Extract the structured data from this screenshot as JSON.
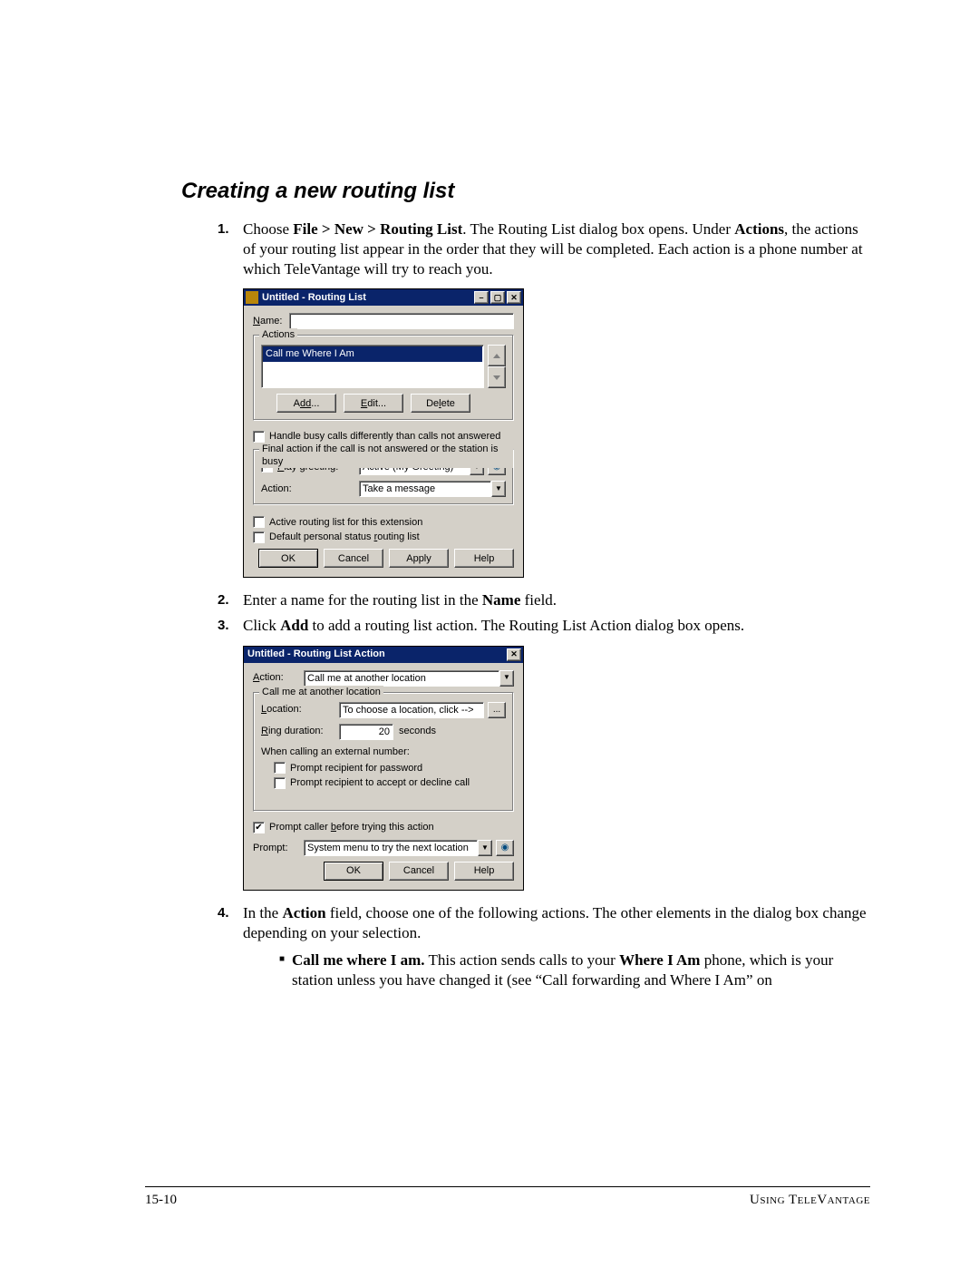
{
  "heading": "Creating a new routing list",
  "step1": {
    "pre": "Choose ",
    "bold1": "File > New > Routing List",
    "mid1": ". The Routing List dialog box opens. Under ",
    "bold2": "Actions",
    "tail": ", the actions of your routing list appear in the order that they will be completed. Each action is a phone number at which TeleVantage will try to reach you."
  },
  "step2": {
    "pre": "Enter a name for the routing list in the ",
    "b": "Name",
    "post": " field."
  },
  "step3": {
    "pre": "Click ",
    "b": "Add",
    "post": " to add a routing list action. The Routing List Action dialog box opens."
  },
  "step4": {
    "pre": "In the ",
    "b": "Action",
    "post": " field, choose one of the following actions. The other elements in the dialog box change depending on your selection."
  },
  "step4sub": {
    "b1": "Call me where I am.",
    "mid": " This action sends calls to your ",
    "b2": "Where I Am",
    "tail": " phone, which is your station unless you have changed it (see “Call forwarding and Where I Am” on"
  },
  "dlg1": {
    "title": "Untitled - Routing List",
    "name_label_a": "N",
    "name_label_b": "ame:",
    "actions_legend": "Actions",
    "list_item": "Call me Where I Am",
    "btn_add_a": "A",
    "btn_add_b": "dd",
    "btn_add_c": "...",
    "btn_edit_a": "E",
    "btn_edit_b": "dit...",
    "btn_delete_a": "De",
    "btn_delete_b": "l",
    "btn_delete_c": "ete",
    "handle_busy": "Handle busy calls differently than calls not answered",
    "final_legend": "Final action if the call is not answered or the station is busy",
    "play_a": "P",
    "play_b": "lay greeting:",
    "greeting_value": "Active (My Greeting)",
    "action_label": "Action:",
    "action_value": "Take a message",
    "active_rl": "Active routing list for this extension",
    "default_ps_a": "Default personal status ",
    "default_ps_b": "r",
    "default_ps_c": "outing list",
    "ok": "OK",
    "cancel": "Cancel",
    "apply": "Apply",
    "help": "Help"
  },
  "dlg2": {
    "title": "Untitled - Routing List Action",
    "action_a": "A",
    "action_b": "ction:",
    "action_value": "Call me at another location",
    "group_legend": "Call me at another location",
    "loc_a": "L",
    "loc_b": "ocation:",
    "loc_value": "To choose a location, click -->",
    "ring_a": "R",
    "ring_b": "ing duration:",
    "ring_value": "20",
    "ring_unit": "seconds",
    "when_ext": "When calling an external number:",
    "prompt_pwd": "Prompt recipient for password",
    "prompt_accept": "Prompt recipient to accept or decline call",
    "prompt_caller_a": "Prompt caller ",
    "prompt_caller_b": "b",
    "prompt_caller_c": "efore trying this action",
    "prompt_label": "Prompt:",
    "prompt_value": "System menu to try the next location",
    "ok": "OK",
    "cancel": "Cancel",
    "help": "Help",
    "browse": "..."
  },
  "footer_left": "15-10",
  "footer_right": "Using TeleVantage"
}
